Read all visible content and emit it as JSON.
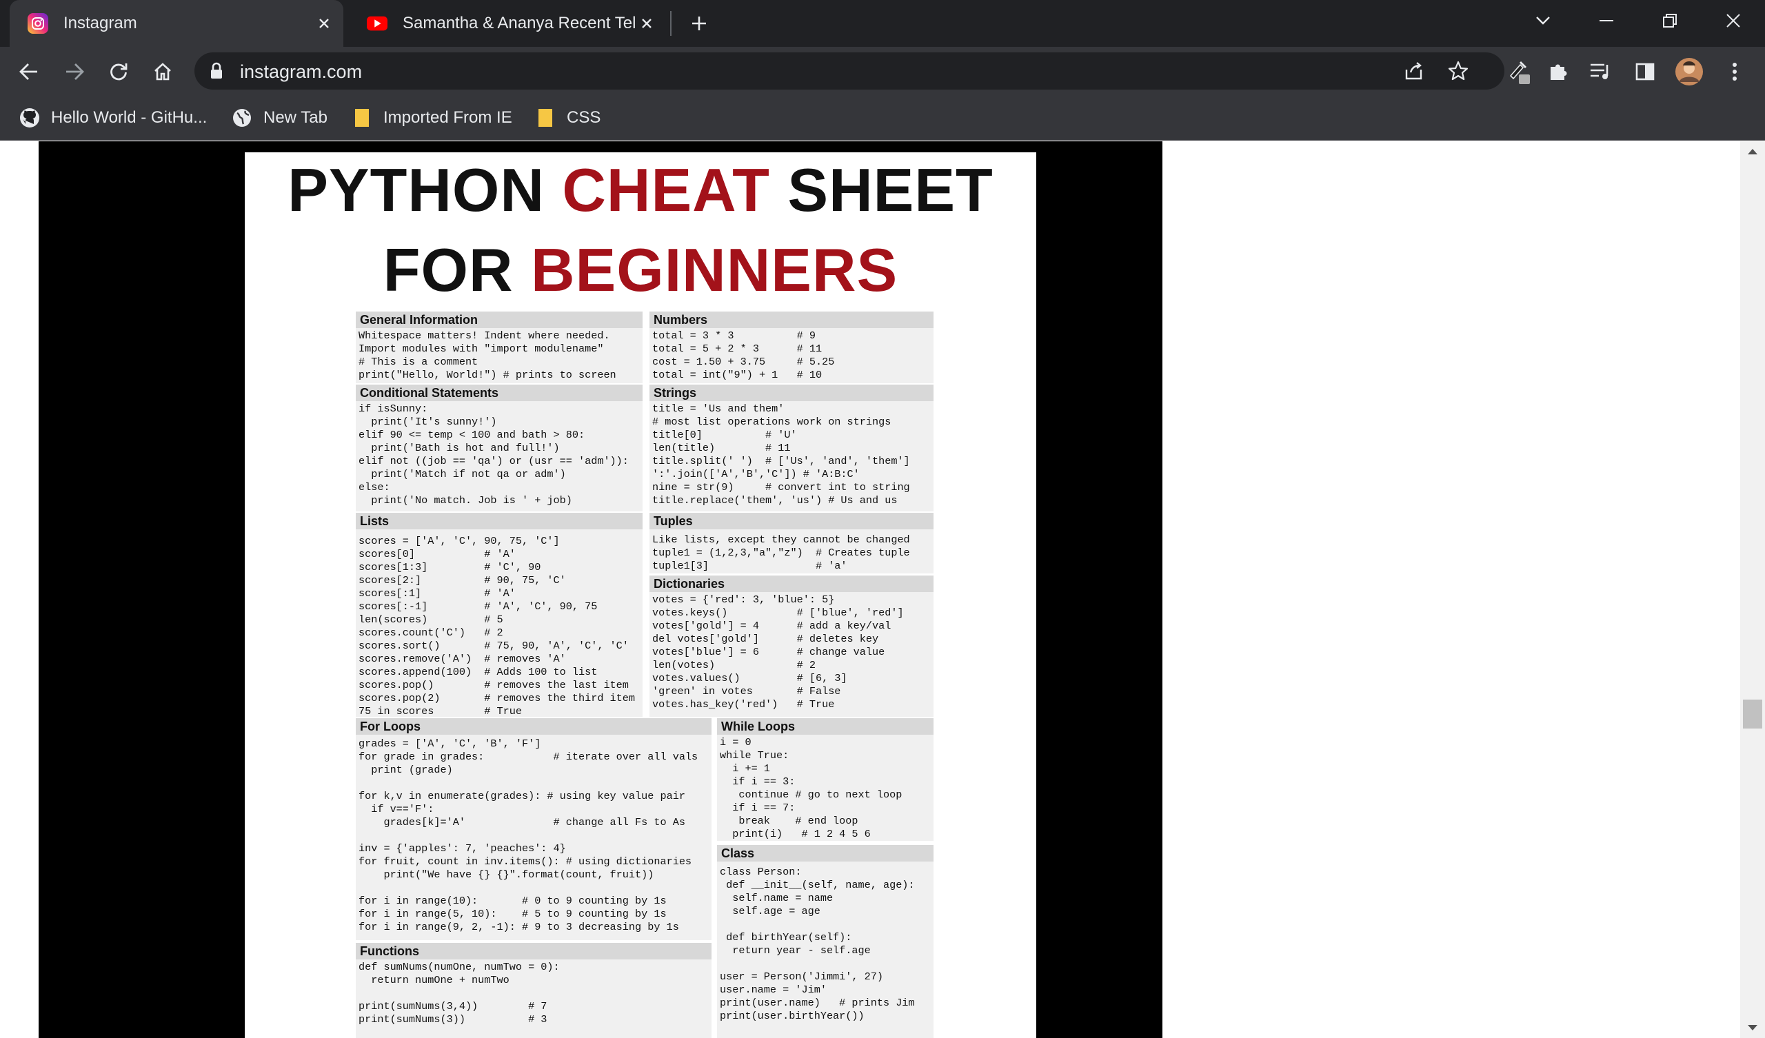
{
  "browser": {
    "tabs": [
      {
        "title": "Instagram",
        "icon": "instagram-icon"
      },
      {
        "title": "Samantha & Ananya Recent Telug",
        "icon": "youtube-icon"
      }
    ],
    "url": "instagram.com",
    "bookmarks": [
      {
        "label": "Hello World - GitHu...",
        "icon": "github-icon"
      },
      {
        "label": "New Tab",
        "icon": "globe-icon"
      },
      {
        "label": "Imported From IE",
        "icon": "folder-icon"
      },
      {
        "label": "CSS",
        "icon": "folder-icon"
      }
    ],
    "colors": {
      "chrome_dark": "#202124",
      "chrome_tab": "#35363a",
      "text": "#e8eaed",
      "instagram": "#d62976",
      "youtube": "#ff0000",
      "folder": "#f6c744"
    }
  },
  "sheet": {
    "title_line1_a": "PYTHON ",
    "title_line1_b": "CHEAT",
    "title_line1_c": " SHEET",
    "title_line2_a": "FOR ",
    "title_line2_b": "BEGINNERS",
    "accent_color": "#a3121a",
    "sections": {
      "general": {
        "heading": "General Information",
        "code": "Whitespace matters! Indent where needed.\nImport modules with \"import modulename\"\n# This is a comment\nprint(\"Hello, World!\") # prints to screen"
      },
      "numbers": {
        "heading": "Numbers",
        "code": "total = 3 * 3          # 9\ntotal = 5 + 2 * 3      # 11\ncost = 1.50 + 3.75     # 5.25\ntotal = int(\"9\") + 1   # 10"
      },
      "conditional": {
        "heading": "Conditional Statements",
        "code": "if isSunny:\n  print('It's sunny!')\nelif 90 <= temp < 100 and bath > 80:\n  print('Bath is hot and full!')\nelif not ((job == 'qa') or (usr == 'adm')):\n  print('Match if not qa or adm')\nelse:\n  print('No match. Job is ' + job)"
      },
      "strings": {
        "heading": "Strings",
        "code": "title = 'Us and them'\n# most list operations work on strings\ntitle[0]          # 'U'\nlen(title)        # 11\ntitle.split(' ')  # ['Us', 'and', 'them']\n':'.join(['A','B','C']) # 'A:B:C'\nnine = str(9)     # convert int to string\ntitle.replace('them', 'us') # Us and us"
      },
      "lists": {
        "heading": "Lists",
        "code": "scores = ['A', 'C', 90, 75, 'C']\nscores[0]           # 'A'\nscores[1:3]         # 'C', 90\nscores[2:]          # 90, 75, 'C'\nscores[:1]          # 'A'\nscores[:-1]         # 'A', 'C', 90, 75\nlen(scores)         # 5\nscores.count('C')   # 2\nscores.sort()       # 75, 90, 'A', 'C', 'C'\nscores.remove('A')  # removes 'A'\nscores.append(100)  # Adds 100 to list\nscores.pop()        # removes the last item\nscores.pop(2)       # removes the third item\n75 in scores        # True"
      },
      "tuples": {
        "heading": "Tuples",
        "code": "Like lists, except they cannot be changed\ntuple1 = (1,2,3,\"a\",\"z\")  # Creates tuple\ntuple1[3]                 # 'a'"
      },
      "dictionaries": {
        "heading": "Dictionaries",
        "code": "votes = {'red': 3, 'blue': 5}\nvotes.keys()           # ['blue', 'red']\nvotes['gold'] = 4      # add a key/val\ndel votes['gold']      # deletes key\nvotes['blue'] = 6      # change value\nlen(votes)             # 2\nvotes.values()         # [6, 3]\n'green' in votes       # False\nvotes.has_key('red')   # True"
      },
      "for_loops": {
        "heading": "For Loops",
        "code": "grades = ['A', 'C', 'B', 'F']\nfor grade in grades:           # iterate over all vals\n  print (grade)\n\nfor k,v in enumerate(grades): # using key value pair\n  if v=='F':\n    grades[k]='A'              # change all Fs to As\n\ninv = {'apples': 7, 'peaches': 4}\nfor fruit, count in inv.items(): # using dictionaries\n    print(\"We have {} {}\".format(count, fruit))\n\nfor i in range(10):       # 0 to 9 counting by 1s\nfor i in range(5, 10):    # 5 to 9 counting by 1s\nfor i in range(9, 2, -1): # 9 to 3 decreasing by 1s"
      },
      "while_loops": {
        "heading": "While Loops",
        "code": "i = 0\nwhile True:\n  i += 1\n  if i == 3:\n   continue # go to next loop\n  if i == 7:\n   break    # end loop\n  print(i)   # 1 2 4 5 6"
      },
      "class": {
        "heading": "Class",
        "code": "class Person:\n def __init__(self, name, age):\n  self.name = name\n  self.age = age\n\n def birthYear(self):\n  return year - self.age\n\nuser = Person('Jimmi', 27)\nuser.name = 'Jim'\nprint(user.name)   # prints Jim\nprint(user.birthYear())"
      },
      "functions": {
        "heading": "Functions",
        "code": "def sumNums(numOne, numTwo = 0):\n  return numOne + numTwo\n\nprint(sumNums(3,4))        # 7\nprint(sumNums(3))          # 3"
      }
    }
  }
}
